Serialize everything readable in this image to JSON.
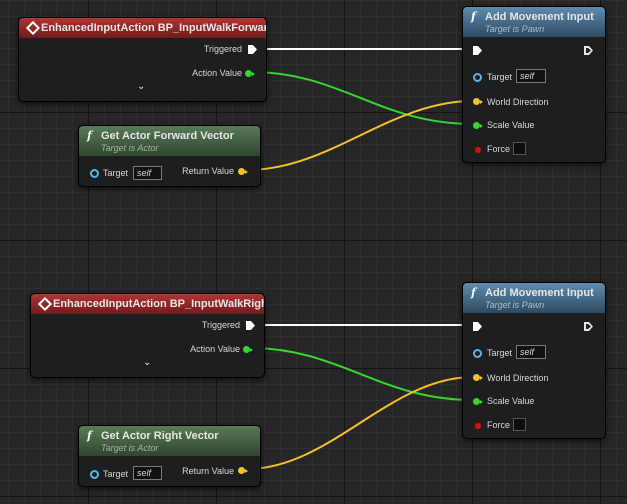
{
  "events": [
    {
      "title": "EnhancedInputAction BP_InputWalkForward",
      "triggered_label": "Triggered",
      "action_value_label": "Action Value",
      "expand_glyph": "⌄"
    },
    {
      "title": "EnhancedInputAction BP_InputWalkRight",
      "triggered_label": "Triggered",
      "action_value_label": "Action Value",
      "expand_glyph": "⌄"
    }
  ],
  "vector_nodes": [
    {
      "icon": "f",
      "title": "Get Actor Forward Vector",
      "subtitle": "Target is Actor",
      "target_label": "Target",
      "target_value": "self",
      "return_label": "Return Value"
    },
    {
      "icon": "f",
      "title": "Get Actor Right Vector",
      "subtitle": "Target is Actor",
      "target_label": "Target",
      "target_value": "self",
      "return_label": "Return Value"
    }
  ],
  "movement_nodes": [
    {
      "icon": "f",
      "title": "Add Movement Input",
      "subtitle": "Target is Pawn",
      "target_label": "Target",
      "target_value": "self",
      "world_direction_label": "World Direction",
      "scale_value_label": "Scale Value",
      "force_label": "Force"
    },
    {
      "icon": "f",
      "title": "Add Movement Input",
      "subtitle": "Target is Pawn",
      "target_label": "Target",
      "target_value": "self",
      "world_direction_label": "World Direction",
      "scale_value_label": "Scale Value",
      "force_label": "Force"
    }
  ],
  "colors": {
    "exec_wire": "#ffffff",
    "float_wire": "#38d52f",
    "vector_wire": "#f5c028",
    "event_header": "#b23333",
    "pure_header": "#5a7a58",
    "function_header": "#5f8cae"
  }
}
